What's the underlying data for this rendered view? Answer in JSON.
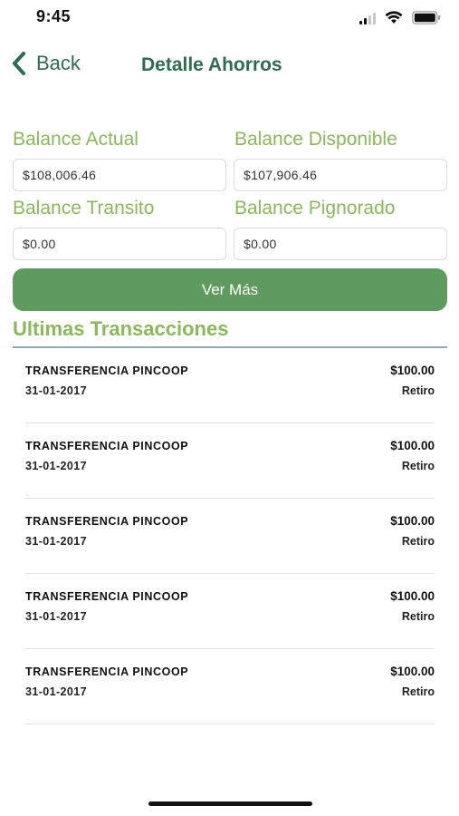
{
  "status_bar": {
    "time": "9:45",
    "icons": [
      "signal-icon",
      "wifi-icon",
      "battery-icon"
    ]
  },
  "nav": {
    "back_label": "Back",
    "title": "Detalle Ahorros",
    "back_icon": "chevron-left-icon"
  },
  "balances": {
    "actual": {
      "label": "Balance Actual",
      "value": "$108,006.46"
    },
    "disponible": {
      "label": "Balance Disponible",
      "value": "$107,906.46"
    },
    "transito": {
      "label": "Balance Transito",
      "value": "$0.00"
    },
    "pignorado": {
      "label": "Balance Pignorado",
      "value": "$0.00"
    }
  },
  "ver_mas_label": "Ver Más",
  "transactions_title": "Ultimas Transacciones",
  "transactions": [
    {
      "title": "TRANSFERENCIA PINCOOP",
      "date": "31-01-2017",
      "amount": "$100.00",
      "type": "Retiro"
    },
    {
      "title": "TRANSFERENCIA PINCOOP",
      "date": "31-01-2017",
      "amount": "$100.00",
      "type": "Retiro"
    },
    {
      "title": "TRANSFERENCIA PINCOOP",
      "date": "31-01-2017",
      "amount": "$100.00",
      "type": "Retiro"
    },
    {
      "title": "TRANSFERENCIA PINCOOP",
      "date": "31-01-2017",
      "amount": "$100.00",
      "type": "Retiro"
    },
    {
      "title": "TRANSFERENCIA PINCOOP",
      "date": "31-01-2017",
      "amount": "$100.00",
      "type": "Retiro"
    }
  ],
  "colors": {
    "brand_dark": "#2e6b4f",
    "label_green": "#8ab85a",
    "button_green": "#5f9b5e"
  }
}
